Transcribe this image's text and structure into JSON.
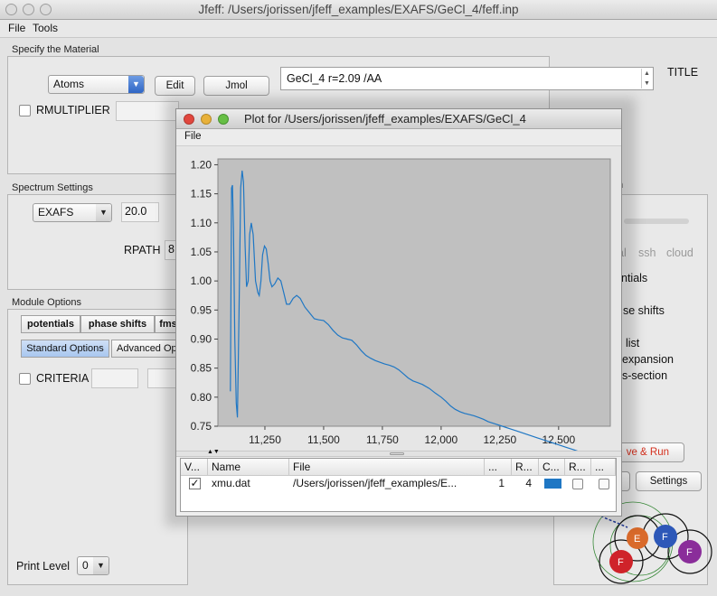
{
  "window": {
    "title": "Jfeff: /Users/jorissen/jfeff_examples/EXAFS/GeCl_4/feff.inp"
  },
  "menu": [
    "File",
    "Tools"
  ],
  "material": {
    "section_label": "Specify the Material",
    "input_type": "Atoms",
    "edit_label": "Edit",
    "jmol_label": "Jmol",
    "title_value": "GeCl_4 r=2.09 /AA",
    "title_label": "TITLE",
    "rmultiplier_label": "RMULTIPLIER"
  },
  "spectrum": {
    "section_label": "Spectrum Settings",
    "type": "EXAFS",
    "value": "20.0",
    "rpath_label": "RPATH",
    "rpath_value": "8"
  },
  "module": {
    "section_label": "Module Options",
    "tabs": [
      "potentials",
      "phase shifts",
      "fms"
    ],
    "subtabs": [
      "Standard Options",
      "Advanced Op"
    ],
    "criteria_label": "CRITERIA"
  },
  "print_level": {
    "label": "Print Level",
    "value": "0"
  },
  "right_panel": {
    "section_tail": "n",
    "run_modes": [
      "al",
      "ssh",
      "cloud"
    ],
    "items": [
      "ntials",
      "se shifts",
      "list",
      "expansion",
      "s-section"
    ],
    "save_run_label": "ve & Run",
    "settings_label": "Settings"
  },
  "plot_window": {
    "title": "Plot for  /Users/jorissen/jfeff_examples/EXAFS/GeCl_4",
    "menu": "File",
    "table": {
      "headers": [
        "V...",
        "Name",
        "File",
        "...",
        "R...",
        "C...",
        "R...",
        "..."
      ],
      "row": {
        "visible": true,
        "name": "xmu.dat",
        "file": "/Users/jorissen/jfeff_examples/E...",
        "col4": "1",
        "col5": "4",
        "color": "#1f77c4"
      }
    }
  },
  "chart_data": {
    "type": "line",
    "title": "",
    "xlabel": "",
    "ylabel": "",
    "xlim": [
      11050,
      12720
    ],
    "ylim": [
      0.75,
      1.21
    ],
    "xticks": [
      "11,250",
      "11,500",
      "11,750",
      "12,000",
      "12,250",
      "12,500"
    ],
    "yticks": [
      "0.75",
      "0.80",
      "0.85",
      "0.90",
      "0.95",
      "1.00",
      "1.05",
      "1.10",
      "1.15",
      "1.20"
    ],
    "grid": false,
    "series": [
      {
        "color": "#1f77c4",
        "x": [
          11103,
          11108,
          11112,
          11116,
          11122,
          11128,
          11133,
          11140,
          11147,
          11153,
          11159,
          11166,
          11172,
          11179,
          11185,
          11192,
          11200,
          11210,
          11220,
          11226,
          11233,
          11240,
          11248,
          11256,
          11264,
          11272,
          11280,
          11292,
          11305,
          11318,
          11330,
          11342,
          11355,
          11370,
          11385,
          11400,
          11420,
          11440,
          11460,
          11480,
          11500,
          11520,
          11540,
          11560,
          11580,
          11600,
          11620,
          11640,
          11660,
          11680,
          11700,
          11720,
          11740,
          11760,
          11780,
          11800,
          11820,
          11840,
          11860,
          11880,
          11900,
          11920,
          11950,
          11975,
          12000,
          12020,
          12040,
          12060,
          12080,
          12100,
          12120,
          12140,
          12160,
          12180,
          12200,
          12230,
          12260,
          12290,
          12320,
          12350,
          12380,
          12410,
          12440,
          12470,
          12500,
          12530,
          12560,
          12590,
          12620,
          12650
        ],
        "y": [
          0.81,
          1.16,
          1.165,
          1.09,
          0.9,
          0.79,
          0.765,
          0.95,
          1.16,
          1.19,
          1.17,
          1.06,
          0.99,
          1.0,
          1.08,
          1.1,
          1.08,
          1.0,
          0.98,
          0.975,
          1.0,
          1.045,
          1.06,
          1.055,
          1.03,
          1.0,
          0.99,
          0.995,
          1.005,
          1.0,
          0.98,
          0.96,
          0.96,
          0.97,
          0.975,
          0.97,
          0.955,
          0.945,
          0.935,
          0.933,
          0.932,
          0.925,
          0.915,
          0.907,
          0.902,
          0.9,
          0.898,
          0.89,
          0.88,
          0.872,
          0.867,
          0.863,
          0.86,
          0.857,
          0.855,
          0.852,
          0.847,
          0.84,
          0.833,
          0.828,
          0.825,
          0.822,
          0.815,
          0.807,
          0.8,
          0.793,
          0.785,
          0.779,
          0.775,
          0.772,
          0.77,
          0.768,
          0.765,
          0.762,
          0.758,
          0.754,
          0.75,
          0.746,
          0.742,
          0.738,
          0.734,
          0.73,
          0.726,
          0.722,
          0.718,
          0.714,
          0.71,
          0.706,
          0.702,
          0.698
        ]
      }
    ]
  }
}
